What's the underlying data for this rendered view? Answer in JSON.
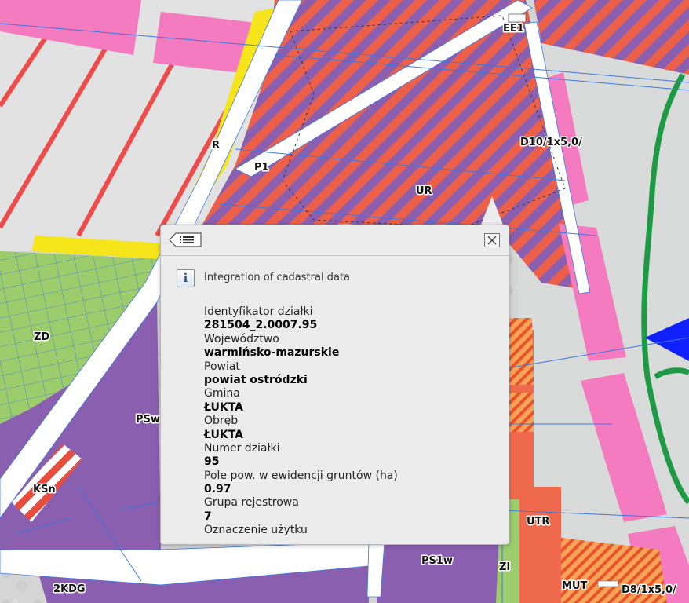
{
  "map": {
    "zone_labels": [
      "EE1",
      "R",
      "P1",
      "UR",
      "D10/1x5,0/",
      "ZD",
      "PSw",
      "KSn",
      "PS1w",
      "ZI",
      "UTR",
      "MUT",
      "D8/1x5,0/",
      "2KDG"
    ]
  },
  "popup": {
    "list_icon": "list-icon",
    "close_icon": "close-icon",
    "info_icon": "i",
    "heading": "Integration of cadastral data",
    "attributes": [
      {
        "label": "Identyfikator działki",
        "value": "281504_2.0007.95"
      },
      {
        "label": "Województwo",
        "value": "warmińsko-mazurskie"
      },
      {
        "label": "Powiat",
        "value": "powiat ostródzki"
      },
      {
        "label": "Gmina",
        "value": "ŁUKTA"
      },
      {
        "label": "Obręb",
        "value": "ŁUKTA"
      },
      {
        "label": "Numer działki",
        "value": "95"
      },
      {
        "label": "Pole pow. w ewidencji gruntów (ha)",
        "value": "0.97"
      },
      {
        "label": "Grupa rejestrowa",
        "value": "7"
      },
      {
        "label": "Oznaczenie użytku",
        "value": ""
      }
    ]
  },
  "colors": {
    "residential": "#8b5fb0",
    "service": "#ef6a4d",
    "green": "#9ccc6b",
    "pink": "#f47bbf",
    "yellow": "#f6e51b",
    "forest_line": "#1e9a44",
    "cadastral_line": "#3c78e0",
    "popup_bg": "#ececec"
  }
}
